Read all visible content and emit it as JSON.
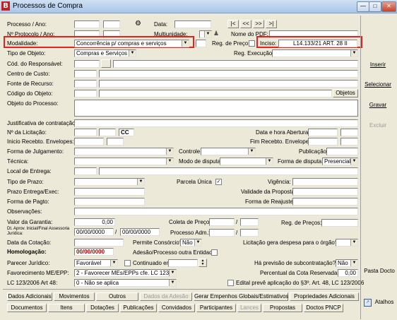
{
  "window": {
    "title": "Processos de Compra",
    "logo": "B"
  },
  "labels": {
    "processo_ano": "Processo / Ano:",
    "protocolo_ano": "Nº Protocolo / Ano:",
    "modalidade": "Modalidade:",
    "tipo_objeto": "Tipo de Objeto:",
    "cod_responsavel": "Cód. do Responsável:",
    "centro_custo": "Centro de Custo:",
    "fonte_recurso": "Fonte de Recurso:",
    "codigo_objeto": "Código do Objeto:",
    "objeto_processo": "Objeto do Processo:",
    "justificativa": "Justificativa de contratação:",
    "n_licitacao": "Nº da Licitação:",
    "inicio_recebto": "Inicio Recebto. Envelopes:",
    "forma_julgamento": "Forma de Julgamento:",
    "tecnica": "Técnica:",
    "local_entrega": "Local de Entrega:",
    "tipo_prazo": "Tipo de Prazo:",
    "prazo_entrega": "Prazo Entrega/Exec:",
    "forma_pagto": "Forma de Pagto:",
    "observacoes": "Observações:",
    "valor_garantia": "Valor da Garantia:",
    "dt_aprov": "Dt. Aprov. Inicial/Final Assessoria Jurídica:",
    "data_cotacao": "Data da Cotação:",
    "homologacao": "Homologação:",
    "parecer_juridico": "Parecer Jurídico:",
    "favorecimento": "Favorecimento ME/EPP:",
    "lc_123": "LC 123/2006 Art 48:",
    "data": "Data:",
    "multiunidade": "Multiunidade:",
    "nome_pdf": "Nome do PDF:",
    "reg_preco": "Reg. de Preço:",
    "inciso": "Inciso:",
    "reg_execucao": "Reg. Execução:",
    "data_hora_abertura": "Data e hora Abertura:",
    "fim_recebto": "Fim Recebto. Envelopes:",
    "controle": "Controle:",
    "publicacao": "Publicação:",
    "modo_disputa": "Modo de disputa:",
    "forma_disputa": "Forma de disputa:",
    "parcela_unica": "Parcela Única",
    "vigencia": "Vigência:",
    "validade_proposta": "Validade da Proposta:",
    "forma_reajuste": "Forma de Reajuste:",
    "coleta_preco": "Coleta de Preço:",
    "reg_precos": "Reg. de Preços:",
    "processo_adm": "Processo Adm.:",
    "permite_consorcio": "Permite Consórcio?",
    "licitacao_despesa": "Licitação gera despesa para o órgão?",
    "adesao_processo": "Adesão/Processo outra Entidade",
    "continuado_em": "Continuado em",
    "previsao_subcontratacao": "Há previsão de subcontratação?",
    "percentual_cota": "Percentual da Cota Reservada:",
    "edital_previo": "Edital prevê aplicação do §3º. Art. 48, LC 123/2006"
  },
  "values": {
    "cc": "CC",
    "modalidade": "Concorrência p/ compras e serviços",
    "inciso": "L14.133/21 ART. 28 II",
    "tipo_objeto": "Compras e Serviços",
    "valor_garantia": "0,00",
    "dt_aprov_inicial": "00/00/0000",
    "dt_aprov_final": "00/00/0000",
    "homologacao": "00/00/0000",
    "permite_consorcio": "Não",
    "parecer_juridico": "Favorável",
    "favorecimento": "2 - Favorecer MEs/EPPs cfe. LC 123/2006",
    "lc_123": "0 - Não se aplica",
    "forma_disputa": "Presencial",
    "previsao_subcontratacao": "Não",
    "percentual_cota": "0,00",
    "sep": "/"
  },
  "nav": {
    "first": "|<",
    "prev": "<<",
    "next": ">>",
    "last": ">|"
  },
  "buttons": {
    "objetos": "Objetos",
    "inserir": "Inserir",
    "selecionar": "Selecionar",
    "gravar": "Gravar",
    "excluir": "Excluir",
    "pasta_docto": "Pasta Docto",
    "atalhos": "Atalhos"
  },
  "tabs_row1": [
    "Dados Adicionais",
    "Movimentos",
    "Outros",
    "Dados da Adesão",
    "Gerar Empenhos Globais/Estimativos",
    "Propriedades Adicionais"
  ],
  "tabs_row2": [
    "Documentos",
    "Itens",
    "Dotações",
    "Publicações",
    "Convidados",
    "Participantes",
    "Lances",
    "Propostas",
    "Doctos PNCP"
  ],
  "winbtns": {
    "min": "—",
    "max": "□",
    "close": "✕"
  }
}
